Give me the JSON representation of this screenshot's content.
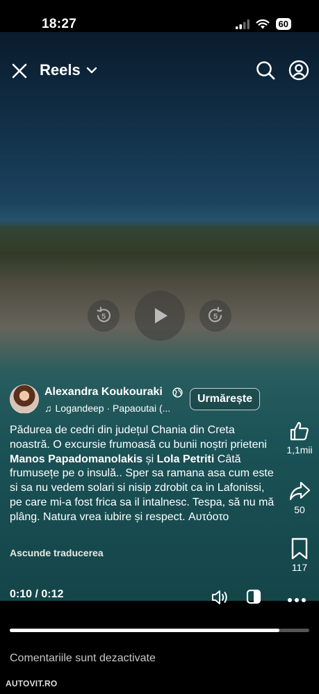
{
  "status_bar": {
    "time": "18:27",
    "battery": "60",
    "icons": [
      "signal-icon",
      "wifi-icon",
      "battery-icon"
    ]
  },
  "header": {
    "title": "Reels",
    "icons": [
      "close-icon",
      "chevron-down-icon",
      "search-icon",
      "profile-icon"
    ]
  },
  "playback": {
    "rewind_label": "5",
    "forward_label": "5"
  },
  "author": {
    "name": "Alexandra Koukouraki",
    "audio": "Logandeep · Papaoutai (...",
    "follow_label": "Urmărește"
  },
  "caption": {
    "text_1": "Pădurea de cedri din județul Chania din Creta noastră. O excursie frumoasă cu bunii noștri prieteni ",
    "tag_1": "Manos Papadomanolakis",
    "text_2": " și ",
    "tag_2": "Lola Petriti",
    "text_3": " Câtă frumusețe pe o insulă.. Sper sa ramana asa cum este si sa nu vedem solari si nisip zdrobit ca in Lafonissi, pe care mi-a fost frica sa il intalnesc. Tespa, să nu mă plâng. Natura vrea iubire și respect. Αυτόοτο",
    "hide_translation": "Ascunde traducerea"
  },
  "actions": {
    "likes": "1,1mii",
    "shares": "50",
    "saves": "117"
  },
  "player": {
    "time": "0:10 / 0:12",
    "progress": 0.9
  },
  "footer": {
    "comments_disabled": "Comentariile sunt dezactivate",
    "watermark": "AUTOVIT.RO"
  },
  "colors": {
    "background": "#000000",
    "text": "#ffffff",
    "progress_track": "#555555"
  }
}
